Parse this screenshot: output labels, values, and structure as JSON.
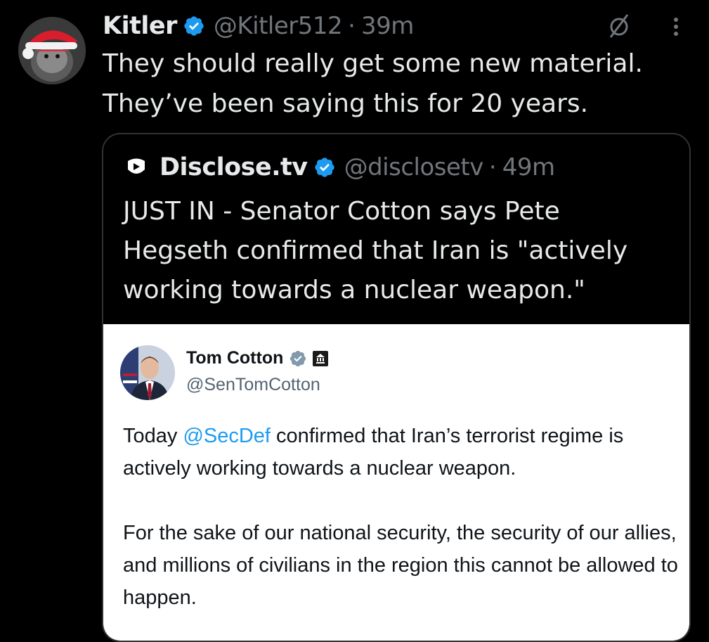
{
  "tweet": {
    "author": {
      "name": "Kitler",
      "handle": "@Kitler512",
      "separator": "·",
      "time": "39m"
    },
    "text": "They should really get some new material.\nThey’ve been saying this for 20 years.",
    "icons": {
      "avatar": "cat-avatar-santa-hat",
      "verified": "verified-badge-icon",
      "mute": "mute-slash-icon",
      "more": "more-vertical-icon"
    }
  },
  "quote": {
    "author": {
      "name": "Disclose.tv",
      "handle": "@disclosetv",
      "separator": "·",
      "time": "49m"
    },
    "text": "JUST IN - Senator Cotton says Pete\nHegseth confirmed that Iran is \"actively\nworking towards a nuclear weapon.\"",
    "icons": {
      "logo": "disclose-tv-logo-icon",
      "verified": "verified-badge-icon"
    }
  },
  "embedded": {
    "name": "Tom Cotton",
    "handle": "@SenTomCotton",
    "text_pre": "Today ",
    "mention": "@SecDef",
    "text_post": " confirmed that Iran’s terrorist regime is actively working towards a nuclear weapon.",
    "paragraph2": "For the sake of our national security, the security of our allies, and millions of civilians in the region this cannot be allowed to happen.",
    "icons": {
      "verified": "gray-verified-badge-icon",
      "government": "government-building-icon"
    }
  },
  "colors": {
    "background": "#000000",
    "text_primary": "#e7e9ea",
    "text_secondary": "#71767b",
    "accent": "#1d9bf0",
    "verified_gray": "#829aab",
    "border": "#2f3336"
  }
}
